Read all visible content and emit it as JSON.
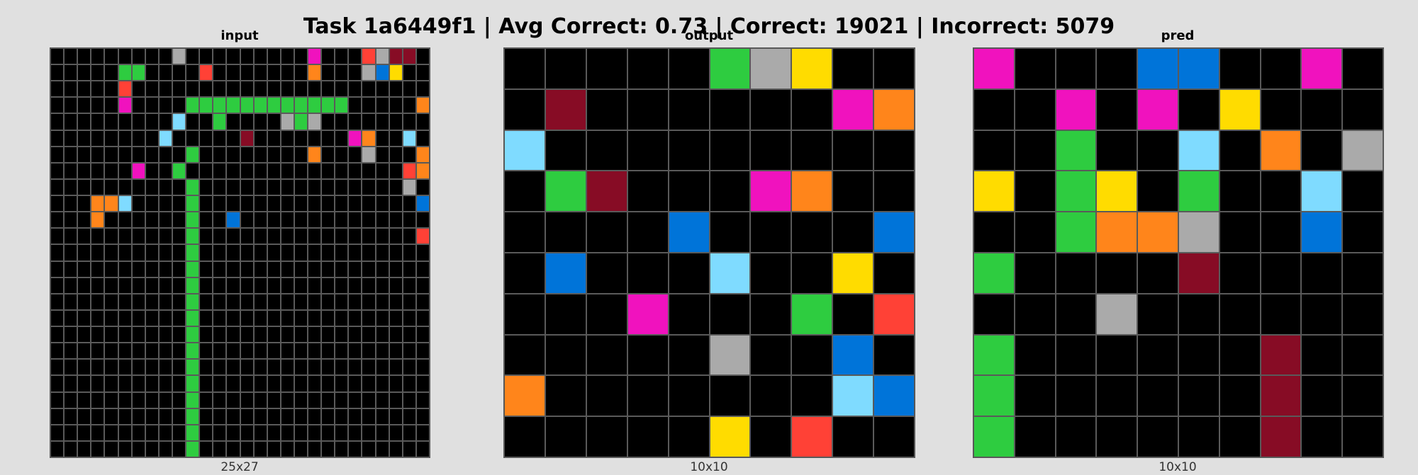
{
  "title": "Task 1a6449f1 | Avg Correct: 0.73 | Correct: 19021 | Incorrect: 5079",
  "palette": {
    "0": "#000000",
    "1": "#0074D9",
    "2": "#FF4136",
    "3": "#2ECC40",
    "4": "#FFDC00",
    "5": "#AAAAAA",
    "6": "#F012BE",
    "7": "#FF851B",
    "8": "#7FDBFF",
    "9": "#870C25"
  },
  "panels": {
    "input": {
      "title": "input",
      "size_label": "25x27",
      "rows": [
        "0000000005000000000600025990",
        "0000033000020000000700051400",
        "0000020000000000000000000000",
        "0000060000333333333333000007",
        "0000000008003000053500000000",
        "0000000080000090000000670080",
        "0000000000300000000700050007",
        "0000006003000000000000000027",
        "0000000000300000000000000050",
        "0007780000300000000000000001",
        "0007000000300100000000000000",
        "0000000000300000000000000002",
        "0000000000300000000000000000",
        "0000000000300000000000000000",
        "0000000000300000000000000000",
        "0000000000300000000000000000",
        "0000000000300000000000000000",
        "0000000000300000000000000000",
        "0000000000300000000000000000",
        "0000000000300000000000000000",
        "0000000000300000000000000000",
        "0000000000300000000000000000",
        "0000000000300000000000000000",
        "0000000000300000000000000000",
        "0000000000300000000000000000"
      ]
    },
    "output": {
      "title": "output",
      "size_label": "10x10",
      "rows": [
        "0000035400",
        "0900000067",
        "8000000000",
        "0390006700",
        "0000100001",
        "0100080040",
        "0006000302",
        "0000050010",
        "7000000081",
        "0000040200"
      ]
    },
    "pred": {
      "title": "pred",
      "size_label": "10x10",
      "rows": [
        "6000110060",
        "0060604000",
        "0030080705",
        "4034030080",
        "0037750010",
        "3000090000",
        "0005000000",
        "3000000900",
        "3000000900",
        "3000000900"
      ]
    }
  }
}
